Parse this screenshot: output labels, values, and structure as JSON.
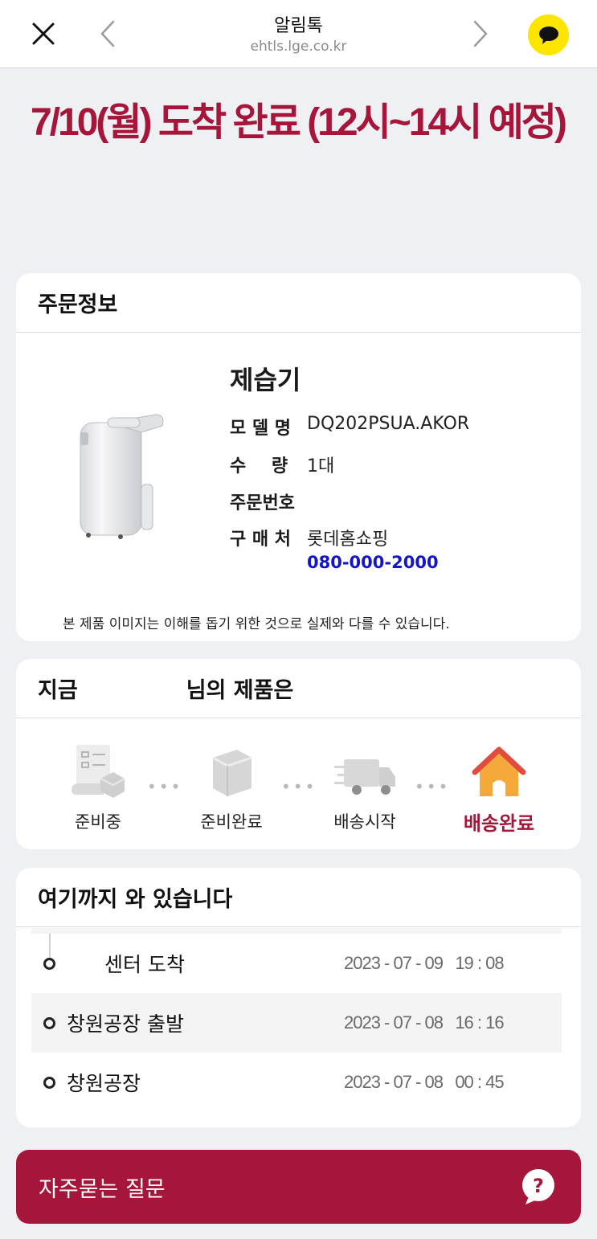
{
  "topbar": {
    "title": "알림톡",
    "url": "ehtls.lge.co.kr"
  },
  "headline": "7/10(월) 도착 완료 (12시~14시 예정)",
  "order": {
    "header": "주문정보",
    "product_name": "제습기",
    "rows": [
      {
        "label": "모 델 명",
        "value": "DQ202PSUA.AKOR"
      },
      {
        "label": "수 량",
        "value": "1대"
      },
      {
        "label": "주문번호",
        "value": ""
      },
      {
        "label": "구 매 처",
        "value": "롯데홈쇼핑"
      }
    ],
    "phone": "080-000-2000",
    "disclaimer": "본 제품 이미지는 이해를 돕기 위한 것으로 실제와 다를 수 있습니다."
  },
  "status": {
    "header_prefix": "지금",
    "header_suffix": "님의 제품은",
    "steps": [
      {
        "label": "준비중",
        "icon": "checklist-box-icon"
      },
      {
        "label": "준비완료",
        "icon": "package-box-icon"
      },
      {
        "label": "배송시작",
        "icon": "delivery-truck-icon"
      },
      {
        "label": "배송완료",
        "icon": "house-icon"
      }
    ],
    "active_step": 3,
    "dots": "•••"
  },
  "tracking": {
    "header": "여기까지 와 있습니다",
    "entries": [
      {
        "place": "센터 도착",
        "time": "2023 - 07 - 09   19 : 08"
      },
      {
        "place": "창원공장 출발",
        "time": "2023 - 07 - 08   16 : 16"
      },
      {
        "place": "창원공장",
        "time": "2023 - 07 - 08   00 : 45"
      }
    ]
  },
  "faq": {
    "label": "자주묻는 질문",
    "icon": "question-bubble-icon"
  },
  "colors": {
    "brand": "#a6163a",
    "phone": "#1515c8",
    "kakao": "#fee500",
    "active_step_icon": "#f39a1e"
  }
}
